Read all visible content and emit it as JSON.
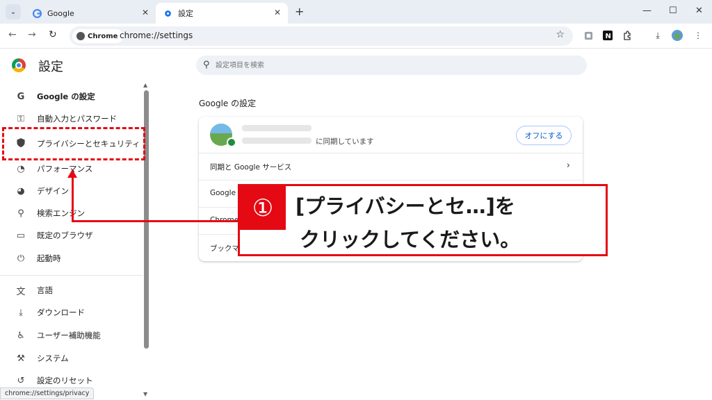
{
  "tabs": [
    {
      "title": "Google",
      "icon": "google-g-icon"
    },
    {
      "title": "設定",
      "icon": "gear-icon"
    }
  ],
  "toolbar": {
    "chip_label": "Chrome",
    "url": "chrome://settings"
  },
  "settings": {
    "title": "設定",
    "search_placeholder": "設定項目を検索"
  },
  "sidebar": {
    "items": [
      {
        "label": "Google の設定",
        "icon": "google-g-icon"
      },
      {
        "label": "自動入力とパスワード",
        "icon": "key-icon"
      },
      {
        "label": "プライバシーとセキュリティ",
        "icon": "shield-icon"
      },
      {
        "label": "パフォーマンス",
        "icon": "speedometer-icon"
      },
      {
        "label": "デザイン",
        "icon": "palette-icon"
      },
      {
        "label": "検索エンジン",
        "icon": "search-icon"
      },
      {
        "label": "既定のブラウザ",
        "icon": "browser-icon"
      },
      {
        "label": "起動時",
        "icon": "power-icon"
      },
      {
        "label": "言語",
        "icon": "translate-icon"
      },
      {
        "label": "ダウンロード",
        "icon": "download-icon"
      },
      {
        "label": "ユーザー補助機能",
        "icon": "accessibility-icon"
      },
      {
        "label": "システム",
        "icon": "wrench-icon"
      },
      {
        "label": "設定のリセット",
        "icon": "reset-icon"
      }
    ]
  },
  "main": {
    "section_title": "Google の設定",
    "sync_suffix": "に同期しています",
    "turn_off_label": "オフにする",
    "rows": [
      {
        "label": "同期と Google サービス"
      },
      {
        "label": "Google"
      },
      {
        "label": "Chrome"
      },
      {
        "label": "ブックマークと設定のインポート"
      }
    ]
  },
  "callout": {
    "badge": "①",
    "line1": "[プライバシーとセ…]を",
    "line2": "クリックしてください。"
  },
  "statusbar": {
    "text": "chrome://settings/privacy"
  },
  "colors": {
    "accent_red": "#e50914",
    "link_blue": "#0b57d0",
    "sync_green": "#1e8e3e"
  }
}
